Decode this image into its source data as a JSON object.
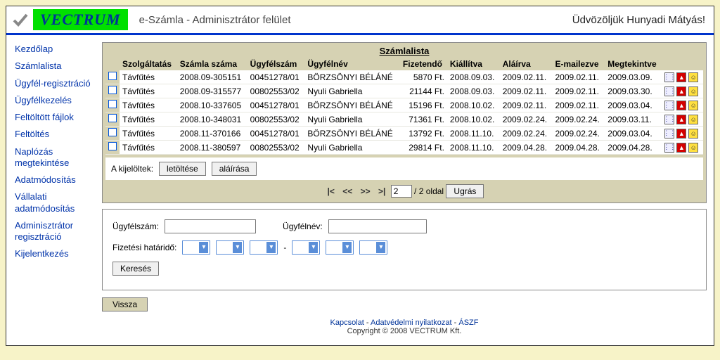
{
  "header": {
    "brand": "VECTRUM",
    "title": "e-Számla - Adminisztrátor felület",
    "welcome": "Üdvözöljük Hunyadi Mátyás!"
  },
  "nav": {
    "items": [
      "Kezdőlap",
      "Számlalista",
      "Ügyfél-regisztráció",
      "Ügyfélkezelés",
      "Feltöltött fájlok",
      "Feltöltés",
      "Naplózás megtekintése",
      "Adatmódosítás",
      "Vállalati adatmódosítás",
      "Adminisztrátor regisztráció",
      "Kijelentkezés"
    ]
  },
  "list": {
    "title": "Számlalista",
    "headers": [
      "Szolgáltatás",
      "Számla száma",
      "Ügyfélszám",
      "Ügyfélnév",
      "Fizetendő",
      "Kiállítva",
      "Aláírva",
      "E-mailezve",
      "Megtekintve"
    ],
    "rows": [
      {
        "szolg": "Távfűtés",
        "szamla": "2008.09-305151",
        "ugyfsz": "00451278/01",
        "nev": "BÖRZSÖNYI BÉLÁNÉ",
        "fiz": "5870 Ft.",
        "kiall": "2008.09.03.",
        "alair": "2009.02.11.",
        "mail": "2009.02.11.",
        "meg": "2009.03.09."
      },
      {
        "szolg": "Távfűtés",
        "szamla": "2008.09-315577",
        "ugyfsz": "00802553/02",
        "nev": "Nyuli Gabriella",
        "fiz": "21144 Ft.",
        "kiall": "2008.09.03.",
        "alair": "2009.02.11.",
        "mail": "2009.02.11.",
        "meg": "2009.03.30."
      },
      {
        "szolg": "Távfűtés",
        "szamla": "2008.10-337605",
        "ugyfsz": "00451278/01",
        "nev": "BÖRZSÖNYI BÉLÁNÉ",
        "fiz": "15196 Ft.",
        "kiall": "2008.10.02.",
        "alair": "2009.02.11.",
        "mail": "2009.02.11.",
        "meg": "2009.03.04."
      },
      {
        "szolg": "Távfűtés",
        "szamla": "2008.10-348031",
        "ugyfsz": "00802553/02",
        "nev": "Nyuli Gabriella",
        "fiz": "71361 Ft.",
        "kiall": "2008.10.02.",
        "alair": "2009.02.24.",
        "mail": "2009.02.24.",
        "meg": "2009.03.11."
      },
      {
        "szolg": "Távfűtés",
        "szamla": "2008.11-370166",
        "ugyfsz": "00451278/01",
        "nev": "BÖRZSÖNYI BÉLÁNÉ",
        "fiz": "13792 Ft.",
        "kiall": "2008.11.10.",
        "alair": "2009.02.24.",
        "mail": "2009.02.24.",
        "meg": "2009.03.04."
      },
      {
        "szolg": "Távfűtés",
        "szamla": "2008.11-380597",
        "ugyfsz": "00802553/02",
        "nev": "Nyuli Gabriella",
        "fiz": "29814 Ft.",
        "kiall": "2008.11.10.",
        "alair": "2009.04.28.",
        "mail": "2009.04.28.",
        "meg": "2009.04.28."
      }
    ],
    "selected_label": "A kijelöltek:",
    "download_btn": "letöltése",
    "sign_btn": "aláírása"
  },
  "pager": {
    "first": "|<",
    "prev": "<<",
    "next": ">>",
    "last": ">|",
    "page_value": "2",
    "page_total": "/ 2 oldal",
    "go_btn": "Ugrás"
  },
  "search": {
    "ugyfelszam_label": "Ügyfélszám:",
    "ugyfelnev_label": "Ügyfélnév:",
    "fhat_label": "Fizetési határidő:",
    "dash": "-",
    "submit": "Keresés"
  },
  "back_btn": "Vissza",
  "footer": {
    "kapcsolat": "Kapcsolat",
    "adat": "Adatvédelmi nyilatkozat",
    "aszf": "ÁSZF",
    "sep": " - ",
    "copyright": "Copyright © 2008 VECTRUM Kft."
  }
}
